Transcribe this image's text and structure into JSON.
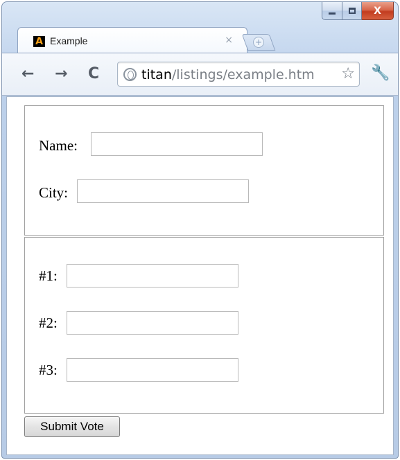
{
  "window": {
    "close_glyph": "X"
  },
  "tab": {
    "favicon_letter": "A",
    "title": "Example",
    "close_glyph": "×",
    "new_tab_glyph": "+"
  },
  "toolbar": {
    "back_glyph": "←",
    "forward_glyph": "→",
    "reload_glyph": "C",
    "star_glyph": "☆",
    "wrench_glyph": "🔧",
    "url_host": "titan",
    "url_path": "/listings/example.htm"
  },
  "form": {
    "fieldsets": [
      {
        "fields": [
          {
            "label": "Name:",
            "value": ""
          },
          {
            "label": "City:",
            "value": ""
          }
        ]
      },
      {
        "fields": [
          {
            "label": "#1:",
            "value": ""
          },
          {
            "label": "#2:",
            "value": ""
          },
          {
            "label": "#3:",
            "value": ""
          }
        ]
      }
    ],
    "submit_label": "Submit Vote"
  },
  "colors": {
    "chrome_blue": "#c9daf0",
    "close_red": "#c23d20",
    "favicon_orange": "#f6a11a"
  },
  "icons": {
    "favicon": "a-logo-icon",
    "back": "back-arrow-icon",
    "forward": "forward-arrow-icon",
    "reload": "reload-icon",
    "site": "globe-icon",
    "bookmark": "star-icon",
    "menu": "wrench-icon"
  }
}
